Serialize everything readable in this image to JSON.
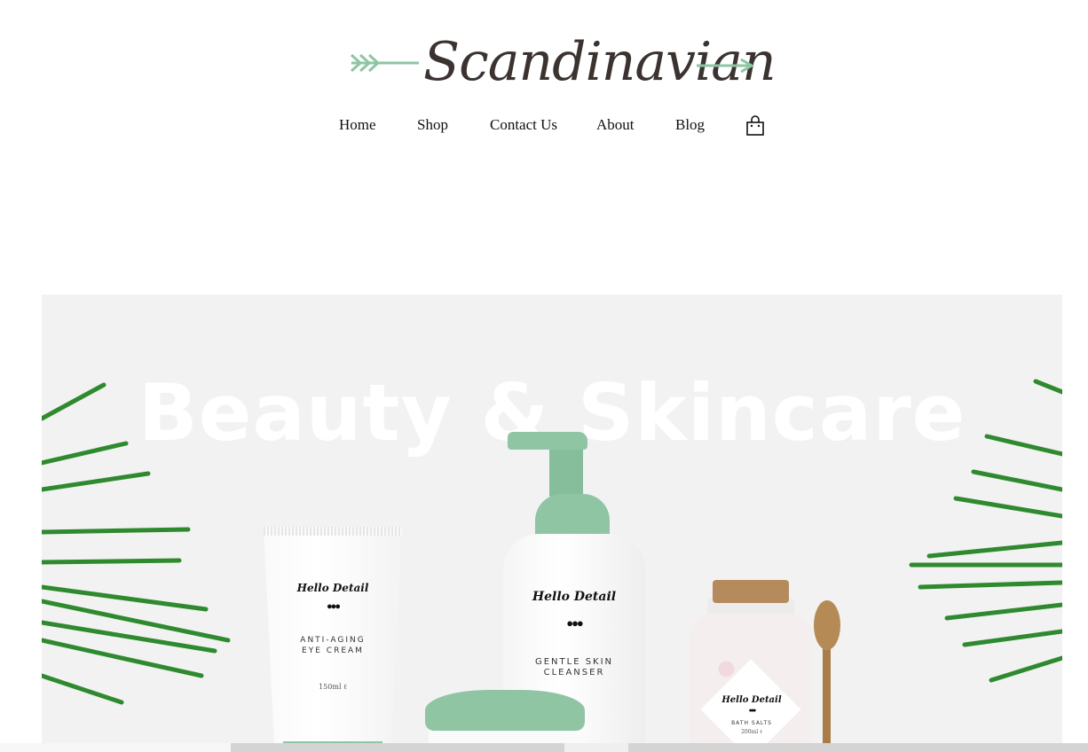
{
  "header": {
    "logo_text": "Scandinavian",
    "accent_color": "#8fc5a3"
  },
  "nav": {
    "items": [
      {
        "label": "Home"
      },
      {
        "label": "Shop"
      },
      {
        "label": "Contact Us"
      },
      {
        "label": "About"
      },
      {
        "label": "Blog"
      }
    ],
    "cart_icon": "shopping-bag-icon"
  },
  "hero": {
    "title": "Beauty & Skincare",
    "background": "#f2f2f2",
    "products": {
      "tube": {
        "brand": "Hello Detail",
        "name_line1": "ANTI-AGING",
        "name_line2": "EYE CREAM",
        "volume": "150ml ℓ"
      },
      "bottle": {
        "brand": "Hello Detail",
        "name_line1": "GENTLE SKIN",
        "name_line2": "CLEANSER"
      },
      "salt_jar": {
        "brand": "Hello Detail",
        "name": "BATH SALTS",
        "volume": "200ml ℓ"
      }
    }
  }
}
